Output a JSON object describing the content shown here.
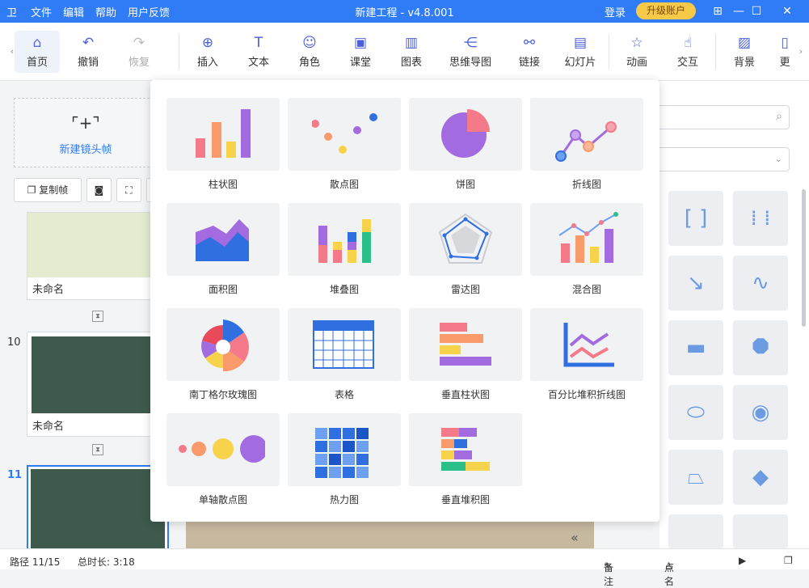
{
  "titlebar": {
    "logo": "卫",
    "menu": [
      "文件",
      "编辑",
      "帮助",
      "用户反馈"
    ],
    "title": "新建工程 - v4.8.001",
    "login": "登录",
    "upgrade": "升级账户",
    "min": "—",
    "max": "☐",
    "close": "✕",
    "pin": "⊞"
  },
  "toolbar": {
    "items": [
      {
        "label": "首页",
        "icon": "home-icon"
      },
      {
        "label": "撤销",
        "icon": "undo-icon"
      },
      {
        "label": "恢复",
        "icon": "redo-icon"
      },
      {
        "label": "插入",
        "icon": "plus-circle-icon"
      },
      {
        "label": "文本",
        "icon": "text-icon"
      },
      {
        "label": "角色",
        "icon": "person-icon"
      },
      {
        "label": "课堂",
        "icon": "classroom-icon"
      },
      {
        "label": "图表",
        "icon": "chart-icon"
      },
      {
        "label": "思维导图",
        "icon": "mindmap-icon"
      },
      {
        "label": "链接",
        "icon": "link-icon"
      },
      {
        "label": "幻灯片",
        "icon": "slide-icon"
      },
      {
        "label": "动画",
        "icon": "star-icon"
      },
      {
        "label": "交互",
        "icon": "hand-icon"
      },
      {
        "label": "背景",
        "icon": "background-icon"
      },
      {
        "label": "更",
        "icon": "more-icon"
      }
    ]
  },
  "leftpanel": {
    "new_frame": "新建镜头帧",
    "copy_frame": "复制帧",
    "slides": [
      {
        "num": "",
        "name": "未命名"
      },
      {
        "num": "10",
        "name": "未命名"
      },
      {
        "num": "11",
        "name": ""
      }
    ]
  },
  "charts": [
    {
      "label": "柱状图",
      "icon": "bar-chart-icon"
    },
    {
      "label": "散点图",
      "icon": "scatter-chart-icon"
    },
    {
      "label": "饼图",
      "icon": "pie-chart-icon"
    },
    {
      "label": "折线图",
      "icon": "line-chart-icon"
    },
    {
      "label": "面积图",
      "icon": "area-chart-icon"
    },
    {
      "label": "堆叠图",
      "icon": "stacked-chart-icon"
    },
    {
      "label": "雷达图",
      "icon": "radar-chart-icon"
    },
    {
      "label": "混合图",
      "icon": "mixed-chart-icon"
    },
    {
      "label": "南丁格尔玫瑰图",
      "icon": "rose-chart-icon"
    },
    {
      "label": "表格",
      "icon": "table-icon"
    },
    {
      "label": "垂直柱状图",
      "icon": "horizontal-bar-icon"
    },
    {
      "label": "百分比堆积折线图",
      "icon": "percent-line-icon"
    },
    {
      "label": "单轴散点图",
      "icon": "single-axis-scatter-icon"
    },
    {
      "label": "热力图",
      "icon": "heatmap-icon"
    },
    {
      "label": "垂直堆积图",
      "icon": "vertical-stack-icon"
    }
  ],
  "statusbar": {
    "path": "路径 11/15",
    "duration": "总时长: 3:18",
    "notes": "备注",
    "rollcall": "点名"
  },
  "colors": {
    "accent": "#2f7cf6",
    "upgrade": "#f7c948"
  }
}
